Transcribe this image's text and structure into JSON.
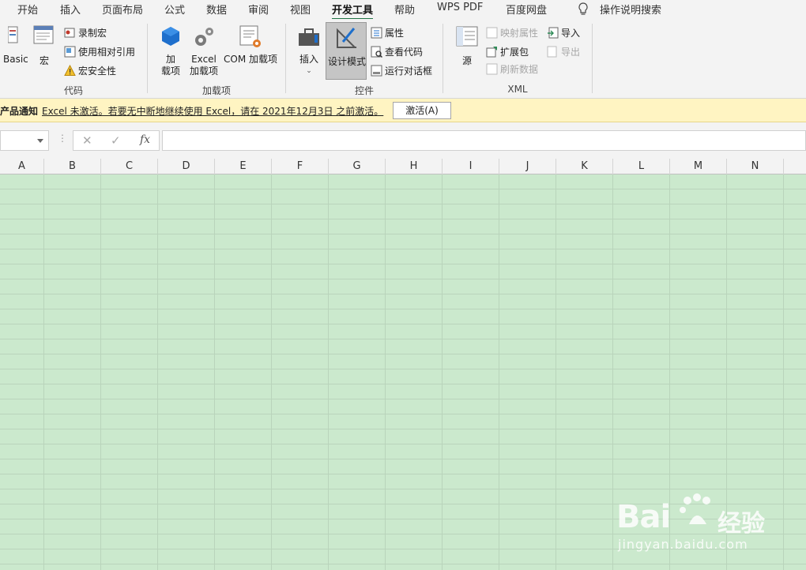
{
  "tabs": [
    "开始",
    "插入",
    "页面布局",
    "公式",
    "数据",
    "审阅",
    "视图",
    "开发工具",
    "帮助",
    "WPS PDF",
    "百度网盘",
    "操作说明搜索"
  ],
  "active_tab": "开发工具",
  "ribbon": {
    "code": {
      "label": "代码",
      "basic": "Basic",
      "macro": "宏",
      "record_macro": "录制宏",
      "relative_ref": "使用相对引用",
      "macro_security": "宏安全性"
    },
    "addins": {
      "label": "加载项",
      "addins_line1": "加",
      "addins_line2": "载项",
      "excel_addins_line1": "Excel",
      "excel_addins_line2": "加载项",
      "com_addins": "COM 加载项"
    },
    "controls": {
      "label": "控件",
      "insert": "插入",
      "design_mode": "设计模式",
      "properties": "属性",
      "view_code": "查看代码",
      "run_dialog": "运行对话框"
    },
    "xml": {
      "label": "XML",
      "source": "源",
      "map_properties": "映射属性",
      "expansion_packs": "扩展包",
      "refresh_data": "刷新数据",
      "import": "导入",
      "export": "导出"
    }
  },
  "notice": {
    "title": "产品通知",
    "message": "Excel 未激活。若要无中断地继续使用 Excel，请在 2021年12月3日 之前激活。",
    "button": "激活(A)"
  },
  "formula_bar": {
    "dots": "⋮",
    "cancel": "✕",
    "enter": "✓",
    "fx": "fx"
  },
  "columns": [
    "A",
    "B",
    "C",
    "D",
    "E",
    "F",
    "G",
    "H",
    "I",
    "J",
    "K",
    "L",
    "M",
    "N"
  ],
  "watermark": {
    "brand": "Bai",
    "brand2": "经验",
    "url": "jingyan.baidu.com"
  },
  "colors": {
    "accent": "#217346",
    "sheet": "#cbe9cd",
    "notice": "#fff4c2"
  }
}
